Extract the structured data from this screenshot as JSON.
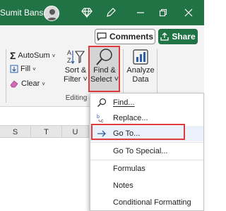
{
  "titlebar": {
    "user_name": "Sumit Bansal",
    "accent": "#217346",
    "icons": [
      "diamond-icon",
      "pen-icon",
      "minimize-icon",
      "restore-icon",
      "close-icon"
    ]
  },
  "actions": {
    "comments_label": "Comments",
    "share_label": "Share"
  },
  "ribbon": {
    "autosum_label": "AutoSum",
    "fill_label": "Fill",
    "clear_label": "Clear",
    "sort_filter_line1": "Sort &",
    "sort_filter_line2": "Filter",
    "find_select_line1": "Find &",
    "find_select_line2": "Select",
    "analyze_line1": "Analyze",
    "analyze_line2": "Data",
    "group_label": "Editing"
  },
  "grid": {
    "columns": [
      "S",
      "T",
      "U"
    ]
  },
  "menu": {
    "items": [
      {
        "label": "Find...",
        "underline": "F",
        "icon": "search-icon"
      },
      {
        "label": "Replace...",
        "underline": "R",
        "icon": "replace-icon"
      },
      {
        "label": "Go To...",
        "underline": "G",
        "icon": "arrow-right-icon"
      },
      {
        "label": "Go To Special...",
        "underline": "S",
        "icon": ""
      },
      {
        "label": "Formulas",
        "underline": "",
        "icon": ""
      },
      {
        "label": "Notes",
        "underline": "",
        "icon": ""
      },
      {
        "label": "Conditional Formatting",
        "underline": "",
        "icon": ""
      }
    ]
  },
  "highlight_color": "#e0393e"
}
